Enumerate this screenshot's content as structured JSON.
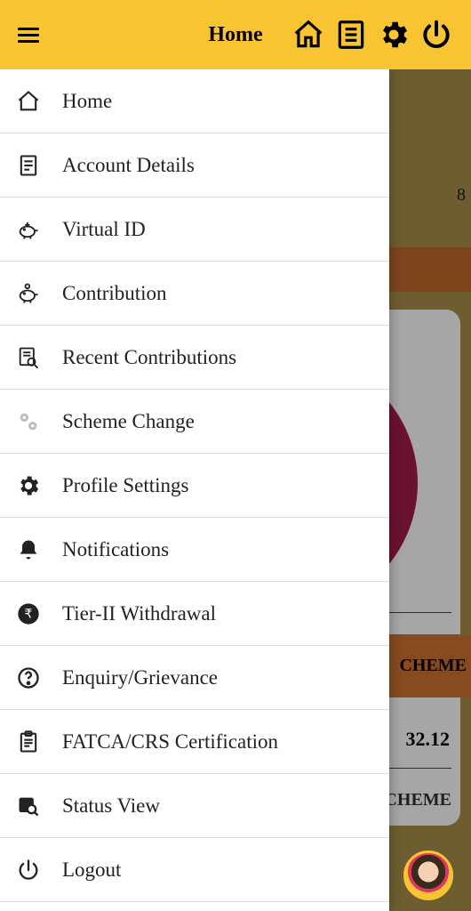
{
  "header": {
    "title": "Home"
  },
  "menu": {
    "items": [
      {
        "label": "Home"
      },
      {
        "label": "Account Details"
      },
      {
        "label": "Virtual ID"
      },
      {
        "label": "Contribution"
      },
      {
        "label": "Recent Contributions"
      },
      {
        "label": "Scheme Change"
      },
      {
        "label": "Profile Settings"
      },
      {
        "label": "Notifications"
      },
      {
        "label": "Tier-II Withdrawal"
      },
      {
        "label": "Enquiry/Grievance"
      },
      {
        "label": "FATCA/CRS Certification"
      },
      {
        "label": "Status View"
      },
      {
        "label": "Logout"
      }
    ]
  },
  "background": {
    "partial_value_top": "8",
    "scheme_label_1": "CHEME",
    "partial_amount": "32.12",
    "scheme_label_2": "CHEME"
  }
}
